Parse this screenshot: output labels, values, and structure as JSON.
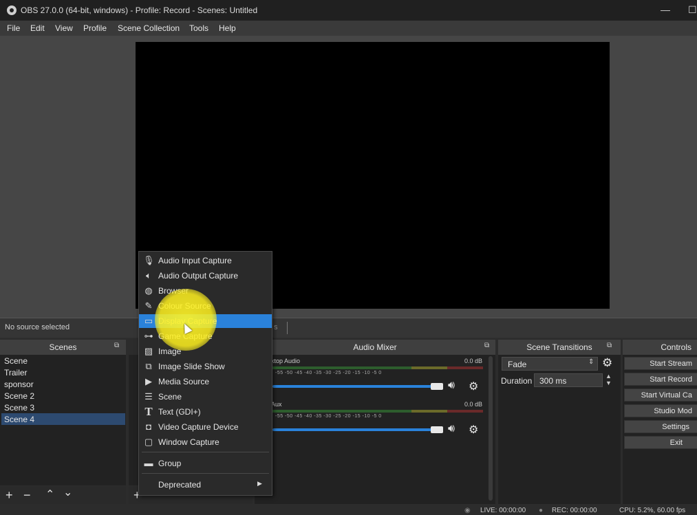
{
  "window": {
    "title": "OBS 27.0.0 (64-bit, windows) - Profile: Record - Scenes: Untitled",
    "minimize_glyph": "—",
    "maximize_glyph": "☐"
  },
  "menu": [
    "File",
    "Edit",
    "View",
    "Profile",
    "Scene Collection",
    "Tools",
    "Help"
  ],
  "source_bar": {
    "status": "No source selected",
    "partial_text": "s"
  },
  "scenes": {
    "title": "Scenes",
    "items": [
      "Scene",
      "Trailer",
      "sponsor",
      "Scene 2",
      "Scene 3",
      "Scene 4"
    ],
    "selected": "Scene 4"
  },
  "audio_mixer": {
    "title": "Audio Mixer",
    "channels": [
      {
        "name": "ktop Audio",
        "db": "0.0 dB"
      },
      {
        "name": "Aux",
        "db": "0.0 dB"
      }
    ],
    "ticks": "-55  -50  -45  -40  -35  -30  -25  -20  -15  -10  -5  0"
  },
  "scene_transitions": {
    "title": "Scene Transitions",
    "transition": "Fade",
    "duration_label": "Duration",
    "duration_value": "300 ms"
  },
  "controls": {
    "title": "Controls",
    "buttons": [
      "Start Stream",
      "Start Record",
      "Start Virtual Ca",
      "Studio Mod",
      "Settings",
      "Exit"
    ]
  },
  "context_menu": {
    "items": [
      {
        "label": "Audio Input Capture",
        "icon": "microphone-icon"
      },
      {
        "label": "Audio Output Capture",
        "icon": "speaker-icon"
      },
      {
        "label": "Browser",
        "icon": "globe-icon"
      },
      {
        "label": "Colour Source",
        "icon": "brush-icon"
      },
      {
        "label": "Display Capture",
        "icon": "monitor-icon",
        "highlighted": true
      },
      {
        "label": "Game Capture",
        "icon": "gamepad-icon"
      },
      {
        "label": "Image",
        "icon": "image-icon"
      },
      {
        "label": "Image Slide Show",
        "icon": "slideshow-icon"
      },
      {
        "label": "Media Source",
        "icon": "play-icon"
      },
      {
        "label": "Scene",
        "icon": "list-icon"
      },
      {
        "label": "Text (GDI+)",
        "icon": "text-icon"
      },
      {
        "label": "Video Capture Device",
        "icon": "camera-icon"
      },
      {
        "label": "Window Capture",
        "icon": "window-icon"
      },
      {
        "label": "Group",
        "icon": "folder-icon"
      },
      {
        "label": "Deprecated",
        "icon": "submenu-arrow-icon"
      }
    ]
  },
  "status": {
    "live": "LIVE: 00:00:00",
    "rec": "REC: 00:00:00",
    "cpu": "CPU: 5.2%, 60.00 fps"
  },
  "colors": {
    "accent": "#2a82da",
    "highlight": "#fff528"
  }
}
